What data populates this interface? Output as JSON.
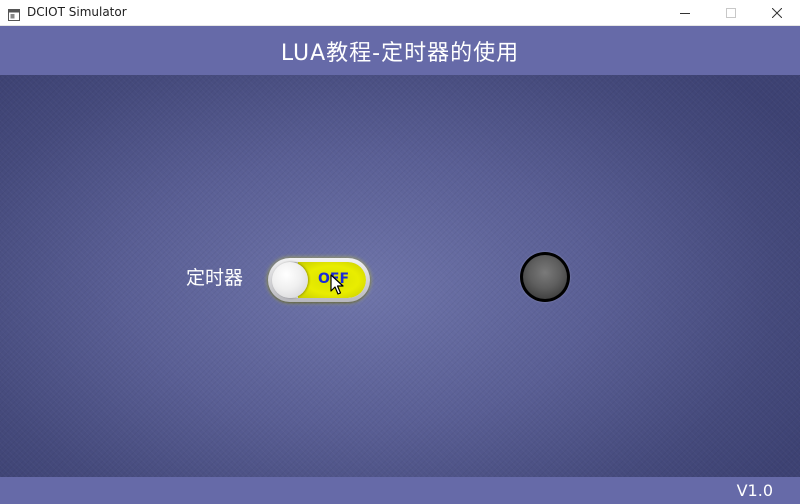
{
  "window": {
    "title": "DCIOT Simulator",
    "icon": "app-window-icon",
    "controls": [
      "minimize-icon",
      "maximize-icon",
      "close-icon"
    ]
  },
  "header": {
    "title": "LUA教程-定时器的使用",
    "background": "#666aa8"
  },
  "main": {
    "timer_label": "定时器",
    "timer_switch": {
      "state_text": "OFF",
      "text_color": "#1a2ad8",
      "fill_color": "#e6ea00"
    },
    "indicator": {
      "state": "off",
      "color": "#5e5e5e"
    }
  },
  "footer": {
    "version": "V1.0"
  }
}
